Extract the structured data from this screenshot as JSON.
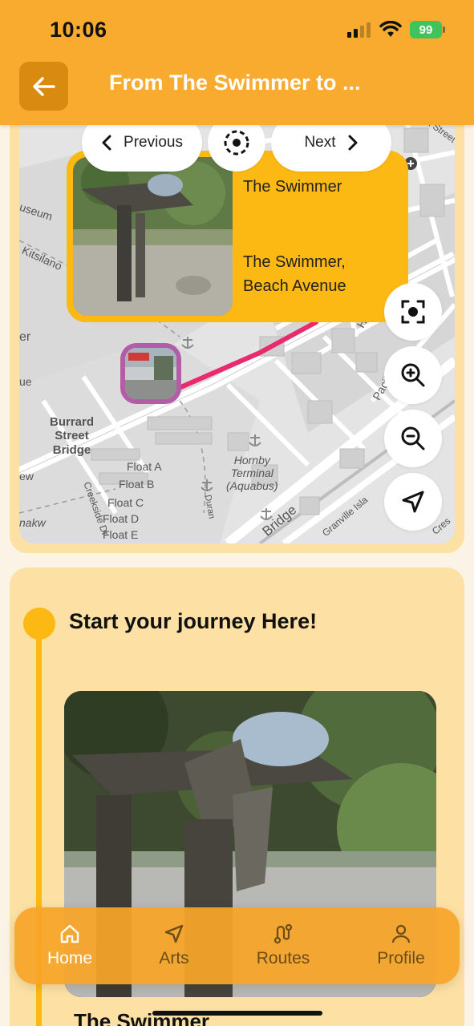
{
  "status_bar": {
    "time": "10:06",
    "battery": "99"
  },
  "header": {
    "title": "From The Swimmer to ...",
    "back_icon": "arrow-left-icon"
  },
  "map": {
    "navigation": {
      "previous_label": "Previous",
      "next_label": "Next",
      "center_icon": "target-dashed-icon"
    },
    "popup": {
      "title": "The Swimmer",
      "subtitle": "The Swimmer, Beach Avenue"
    },
    "labels": {
      "burrard": "Burrard\nStreet\nBridge",
      "float_a": "Float A",
      "float_b": "Float B",
      "float_c": "Float C",
      "float_d": "Float D",
      "float_e": "Float E",
      "hornby": "Hornby\nTerminal\n(Aquabus)",
      "museum": "useum",
      "kitsilano": "Kitsilano",
      "creekside": "Creekside Dr",
      "bridge": "Bridge",
      "granville": "Granville Isla",
      "pacific": "Pacific",
      "homer": "Ho",
      "fromox": "omox Street",
      "duran": "Duran",
      "nakw": "nakw",
      "ew": "ew",
      "er": "er",
      "ue": "ue",
      "cres": "Cres"
    },
    "controls": [
      {
        "name": "focus-button",
        "icon": "focus-frame-icon"
      },
      {
        "name": "zoom-in-button",
        "icon": "zoom-in-icon"
      },
      {
        "name": "zoom-out-button",
        "icon": "zoom-out-icon"
      },
      {
        "name": "locate-button",
        "icon": "navigation-arrow-icon"
      }
    ],
    "route_color": "#ea2a6f"
  },
  "journey": {
    "heading": "Start your journey Here!",
    "caption": "The Swimmer"
  },
  "bottom_nav": {
    "items": [
      {
        "label": "Home",
        "icon": "home-icon",
        "active": true
      },
      {
        "label": "Arts",
        "icon": "navigation-icon",
        "active": false
      },
      {
        "label": "Routes",
        "icon": "route-icon",
        "active": false
      },
      {
        "label": "Profile",
        "icon": "user-icon",
        "active": false
      }
    ]
  },
  "colors": {
    "primary": "#f9ab2f",
    "accent": "#fdb913",
    "card": "#fde1a4",
    "marker": "#b35ca8"
  }
}
